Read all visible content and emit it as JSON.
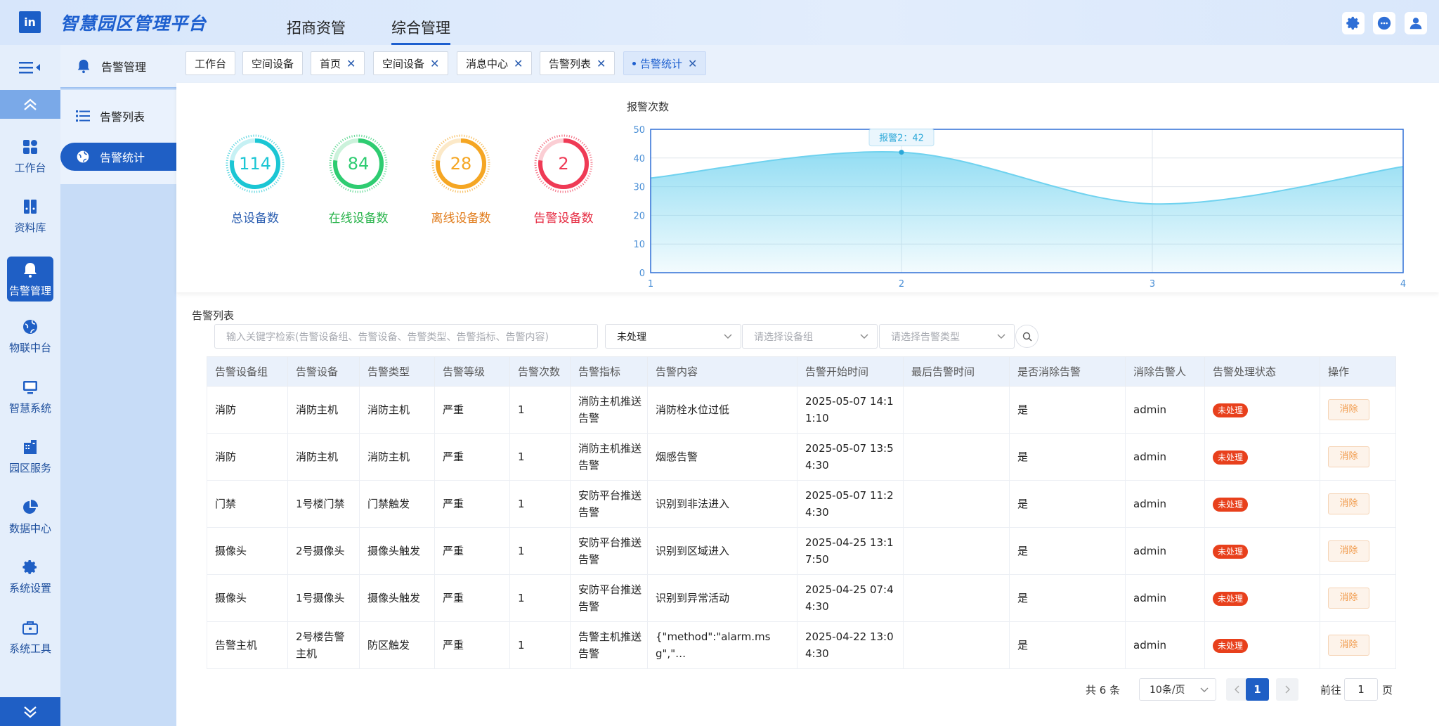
{
  "header": {
    "logo": "in",
    "title": "智慧园区管理平台",
    "nav": [
      {
        "label": "招商资管",
        "active": false
      },
      {
        "label": "综合管理",
        "active": true
      }
    ]
  },
  "rail": {
    "items": [
      {
        "label": "工作台",
        "icon": "grid-icon"
      },
      {
        "label": "资料库",
        "icon": "binder-icon"
      },
      {
        "label": "告警管理",
        "icon": "bell-icon",
        "active": true
      },
      {
        "label": "物联中台",
        "icon": "globe-icon"
      },
      {
        "label": "智慧系统",
        "icon": "monitor-icon"
      },
      {
        "label": "园区服务",
        "icon": "building-icon"
      },
      {
        "label": "数据中心",
        "icon": "pie-icon"
      },
      {
        "label": "系统设置",
        "icon": "gear-icon"
      },
      {
        "label": "系统工具",
        "icon": "toolbox-icon"
      }
    ]
  },
  "submenu": {
    "title": "告警管理",
    "items": [
      {
        "label": "告警列表",
        "active": false
      },
      {
        "label": "告警统计",
        "active": true
      }
    ]
  },
  "tabs": [
    {
      "label": "工作台",
      "closable": false
    },
    {
      "label": "空间设备",
      "closable": false
    },
    {
      "label": "首页",
      "closable": true
    },
    {
      "label": "空间设备",
      "closable": true
    },
    {
      "label": "消息中心",
      "closable": true
    },
    {
      "label": "告警列表",
      "closable": true
    },
    {
      "label": "告警统计",
      "closable": true,
      "active": true
    }
  ],
  "stats": [
    {
      "label": "总设备数",
      "value": "114",
      "color": "#1bc6d4",
      "label_color": "#2a5db0"
    },
    {
      "label": "在线设备数",
      "value": "84",
      "color": "#2ecc71",
      "label_color": "#27b34a"
    },
    {
      "label": "离线设备数",
      "value": "28",
      "color": "#f5a623",
      "label_color": "#e07b1a"
    },
    {
      "label": "告警设备数",
      "value": "2",
      "color": "#ef3a55",
      "label_color": "#e5283f"
    }
  ],
  "chart_data": {
    "type": "area",
    "title": "报警次数",
    "x": [
      1,
      2,
      3,
      4
    ],
    "series": [
      {
        "name": "报警2",
        "values": [
          33,
          42,
          24,
          37
        ]
      }
    ],
    "ylim": [
      0,
      50
    ],
    "yticks": [
      0,
      10,
      20,
      30,
      40,
      50
    ],
    "tooltip": "报警2：42",
    "tooltip_index": 1,
    "color": "#6fd2ef",
    "grid": true
  },
  "list": {
    "title": "告警列表",
    "search_placeholder": "输入关键字检索(告警设备组、告警设备、告警类型、告警指标、告警内容)",
    "status_filter": "未处理",
    "device_group_placeholder": "请选择设备组",
    "alarm_type_placeholder": "请选择告警类型",
    "columns": [
      "告警设备组",
      "告警设备",
      "告警类型",
      "告警等级",
      "告警次数",
      "告警指标",
      "告警内容",
      "告警开始时间",
      "最后告警时间",
      "是否消除告警",
      "消除告警人",
      "告警处理状态",
      "操作"
    ],
    "rows": [
      [
        "消防",
        "消防主机",
        "消防主机",
        "严重",
        "1",
        "消防主机推送告警",
        "消防栓水位过低",
        "2025-05-07 14:11:10",
        "",
        "是",
        "admin",
        "未处理",
        "消除"
      ],
      [
        "消防",
        "消防主机",
        "消防主机",
        "严重",
        "1",
        "消防主机推送告警",
        "烟感告警",
        "2025-05-07 13:54:30",
        "",
        "是",
        "admin",
        "未处理",
        "消除"
      ],
      [
        "门禁",
        "1号楼门禁",
        "门禁触发",
        "严重",
        "1",
        "安防平台推送告警",
        "识别到非法进入",
        "2025-05-07 11:24:30",
        "",
        "是",
        "admin",
        "未处理",
        "消除"
      ],
      [
        "摄像头",
        "2号摄像头",
        "摄像头触发",
        "严重",
        "1",
        "安防平台推送告警",
        "识别到区域进入",
        "2025-04-25 13:17:50",
        "",
        "是",
        "admin",
        "未处理",
        "消除"
      ],
      [
        "摄像头",
        "1号摄像头",
        "摄像头触发",
        "严重",
        "1",
        "安防平台推送告警",
        "识别到异常活动",
        "2025-04-25 07:44:30",
        "",
        "是",
        "admin",
        "未处理",
        "消除"
      ],
      [
        "告警主机",
        "2号楼告警主机",
        "防区触发",
        "严重",
        "1",
        "告警主机推送告警",
        "{\"method\":\"alarm.msg\",\"…",
        "2025-04-22 13:04:30",
        "",
        "是",
        "admin",
        "未处理",
        "消除"
      ]
    ]
  },
  "pager": {
    "total": "共 6 条",
    "page_size": "10条/页",
    "current": "1",
    "goto_label": "前往",
    "goto_value": "1",
    "goto_unit": "页"
  }
}
